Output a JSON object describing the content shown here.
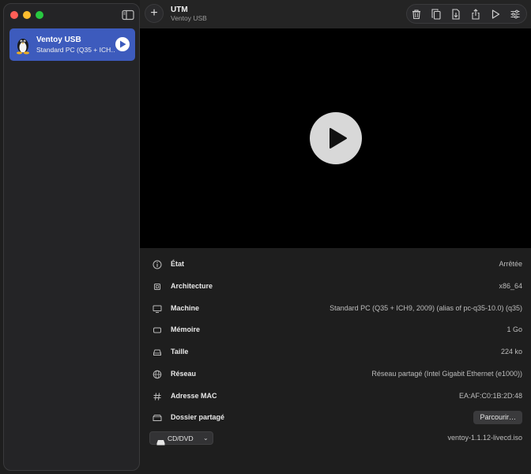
{
  "sidebar": {
    "vms": [
      {
        "name": "Ventoy USB",
        "subtitle": "Standard PC (Q35 + ICH…"
      }
    ]
  },
  "toolbar": {
    "title": "UTM",
    "subtitle": "Ventoy USB",
    "add_label": "+",
    "icons": [
      "trash-icon",
      "clone-icon",
      "download-icon",
      "share-icon",
      "play-icon",
      "settings-icon"
    ]
  },
  "details": {
    "rows": [
      {
        "icon": "info-icon",
        "label": "État",
        "value": "Arrêtée"
      },
      {
        "icon": "cpu-icon",
        "label": "Architecture",
        "value": "x86_64"
      },
      {
        "icon": "display-icon",
        "label": "Machine",
        "value": "Standard PC (Q35 + ICH9, 2009) (alias of pc-q35-10.0) (q35)"
      },
      {
        "icon": "memory-icon",
        "label": "Mémoire",
        "value": "1 Go"
      },
      {
        "icon": "drive-icon",
        "label": "Taille",
        "value": "224 ko"
      },
      {
        "icon": "globe-icon",
        "label": "Réseau",
        "value": "Réseau partagé (Intel Gigabit Ethernet (e1000))"
      },
      {
        "icon": "hash-icon",
        "label": "Adresse MAC",
        "value": "EA:AF:C0:1B:2D:48"
      },
      {
        "icon": "shared-folder-icon",
        "label": "Dossier partagé",
        "button": "Parcourir…"
      }
    ],
    "cd": {
      "label": "CD/DVD",
      "value": "ventoy-1.1.12-livecd.iso"
    }
  },
  "colors": {
    "selection": "#3d5bbd",
    "background": "#1e1e1e",
    "video": "#000000"
  }
}
